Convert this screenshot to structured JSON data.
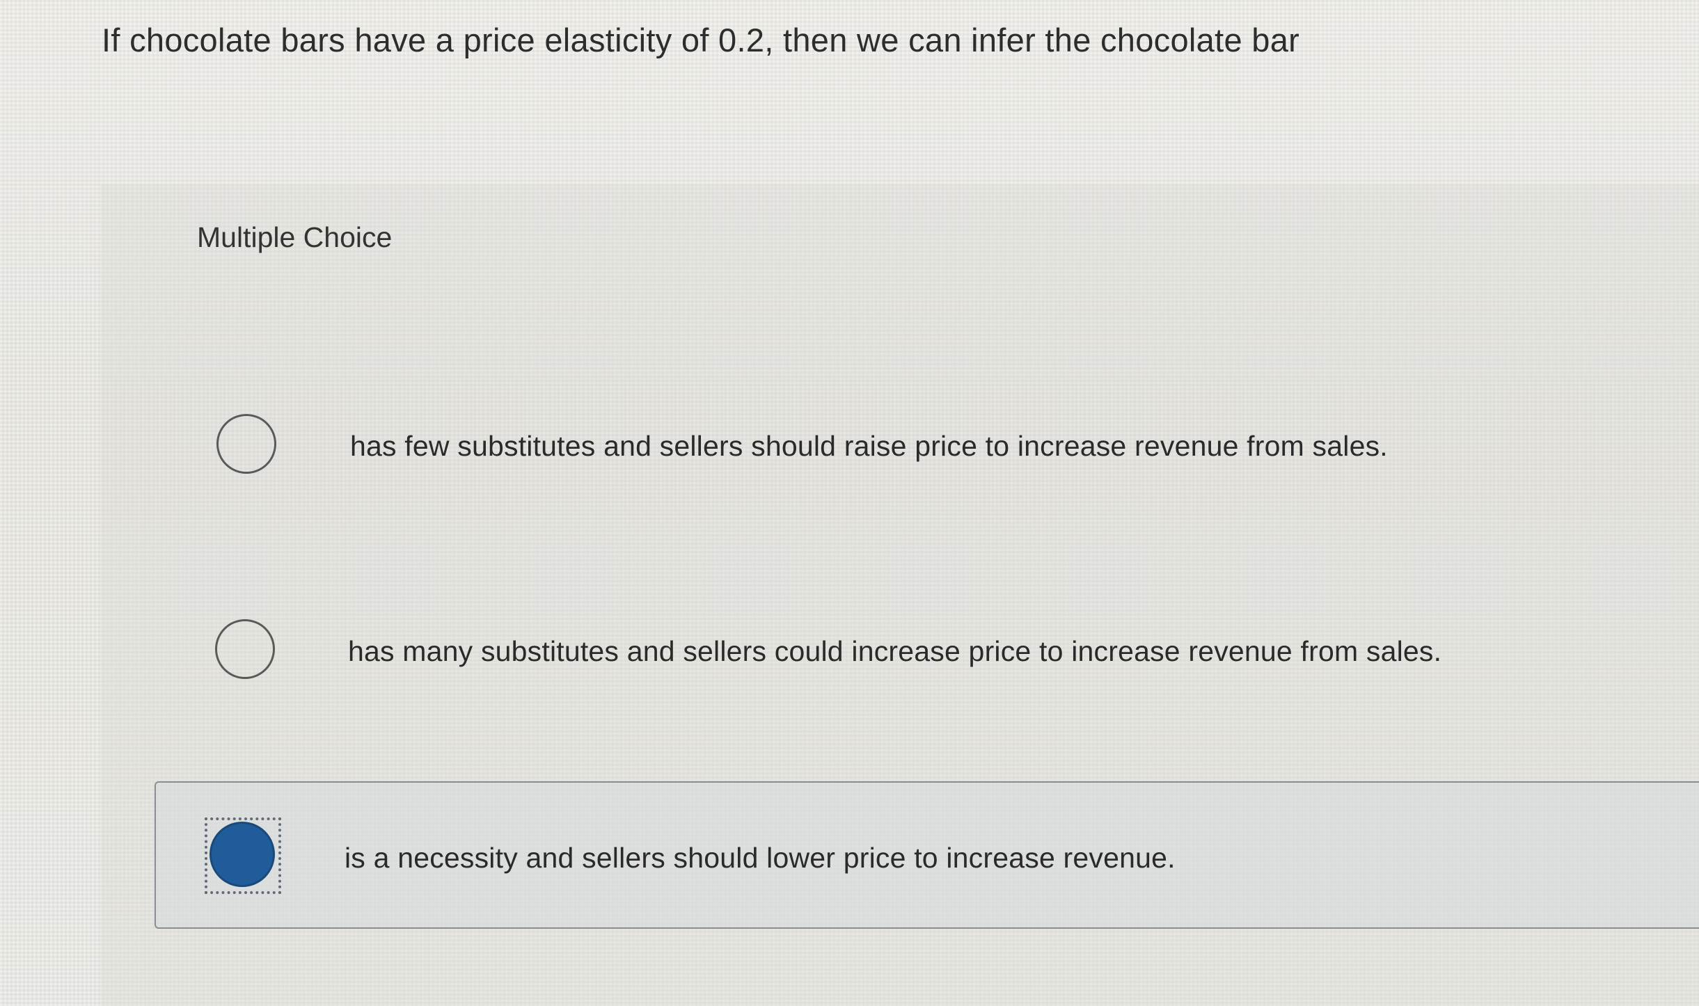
{
  "question": {
    "text": "If chocolate bars have a price elasticity of 0.2, then we can infer the chocolate bar"
  },
  "multiple_choice": {
    "header": "Multiple Choice",
    "options": [
      {
        "label": "has few substitutes and sellers should raise price to increase revenue from sales.",
        "selected": false
      },
      {
        "label": "has many substitutes and sellers could increase price to increase revenue from sales.",
        "selected": false
      },
      {
        "label": "is a necessity and sellers should lower price to increase revenue.",
        "selected": true
      }
    ]
  },
  "colors": {
    "selected_radio": "#1f5c99",
    "background": "#e9e8e3"
  }
}
